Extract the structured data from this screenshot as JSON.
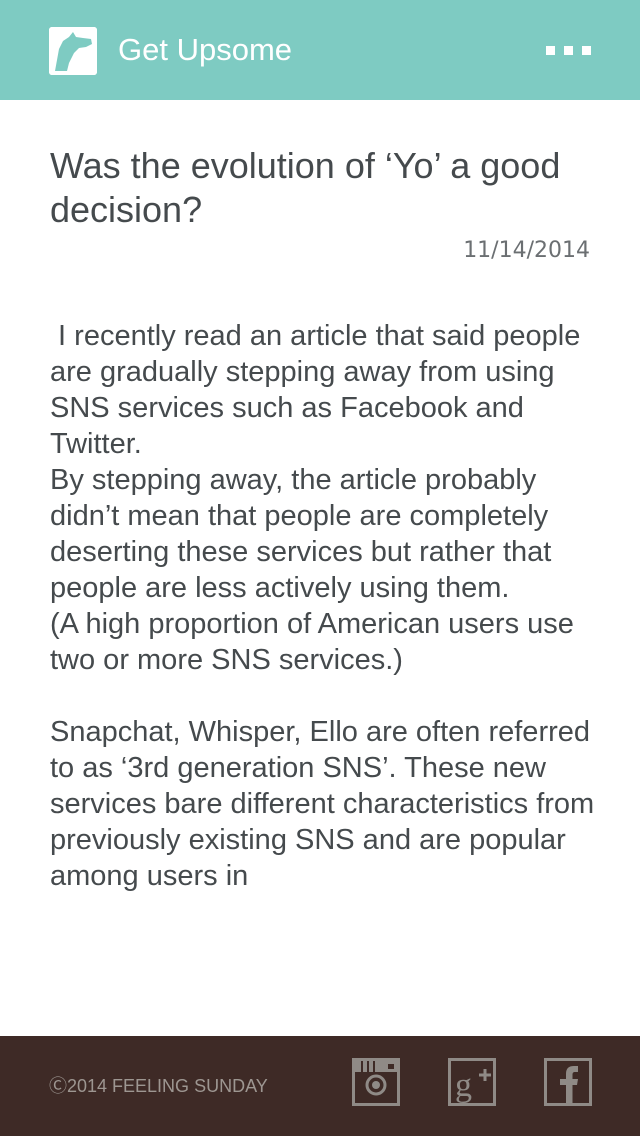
{
  "header": {
    "app_title": "Get Upsome",
    "logo_icon": "dog-head-icon",
    "menu_icon": "more-dots-icon"
  },
  "article": {
    "title": "Was the evolution of ‘Yo’ a good decision?",
    "date": "11/14/2014",
    "paragraphs": [
      " I recently read an article that said people are gradually stepping away from using SNS services such as Facebook and Twitter.",
      "By stepping away, the article probably didn’t mean that people are completely deserting these services but rather that people are less actively using them.",
      "(A high proportion of American users use two or more SNS services.)",
      "Snapchat, Whisper, Ello are often referred to as ‘3rd generation SNS’. These new services bare different characteristics from previously existing SNS and are popular among users in"
    ]
  },
  "footer": {
    "copyright": "Ⓒ2014 FEELING SUNDAY",
    "social": [
      {
        "icon": "instagram-icon"
      },
      {
        "icon": "google-plus-icon"
      },
      {
        "icon": "facebook-icon"
      }
    ]
  },
  "colors": {
    "header_bg": "#7ecbc2",
    "footer_bg": "#3e2a26",
    "text": "#454a4d"
  }
}
